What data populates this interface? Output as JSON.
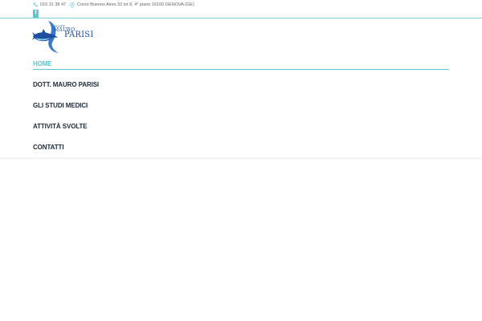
{
  "topbar": {
    "phone": "010 31 38 47",
    "address": "Corso Buenos Aires 32 int 8, 4° piano 16100 GENOVA (GE)",
    "phone_icon": "phone-icon",
    "address_icon": "map-pin-icon"
  },
  "social": {
    "facebook_glyph": "f",
    "facebook_icon": "facebook-icon"
  },
  "logo": {
    "line1": "DOTT.",
    "line2": "MAURO",
    "line3": "PARISI"
  },
  "nav": {
    "items": [
      {
        "label": "HOME"
      },
      {
        "label": "DOTT. MAURO PARISI"
      },
      {
        "label": "GLI STUDI MEDICI"
      },
      {
        "label": "ATTIVITÀ SVOLTE"
      },
      {
        "label": "CONTATTI"
      }
    ]
  },
  "colors": {
    "accent": "#5ac6d6",
    "nav_text": "#1d2a38",
    "logo_blue": "#1e4fa3"
  }
}
